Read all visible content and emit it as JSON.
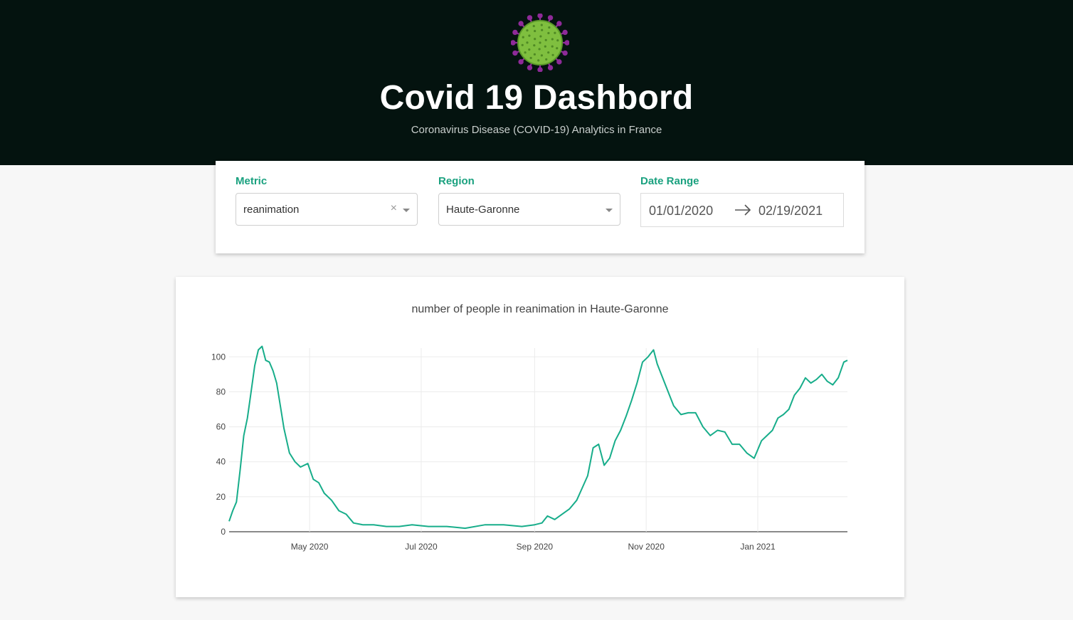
{
  "header": {
    "logo_icon": "virus-icon",
    "title": "Covid 19 Dashbord",
    "subtitle": "Coronavirus Disease (COVID-19) Analytics in France",
    "background": "#04130f"
  },
  "filters": {
    "metric": {
      "label": "Metric",
      "value": "reanimation",
      "clear_symbol": "×"
    },
    "region": {
      "label": "Region",
      "value": "Haute-Garonne"
    },
    "date_range": {
      "label": "Date Range",
      "start": "01/01/2020",
      "end": "02/19/2021",
      "arrow_icon": "arrow-right-icon"
    },
    "accent_color": "#1aa17f"
  },
  "chart_data": {
    "type": "line",
    "title": "number of people in reanimation in Haute-Garonne",
    "xlabel": "",
    "ylabel": "",
    "x_ticks": [
      "May 2020",
      "Jul 2020",
      "Sep 2020",
      "Nov 2020",
      "Jan 2021"
    ],
    "y_ticks": [
      0,
      20,
      40,
      60,
      80,
      100
    ],
    "ylim": [
      0,
      105
    ],
    "grid": true,
    "line_color": "#17ad8a",
    "series": [
      {
        "x": [
          "2020-03-18",
          "2020-03-20",
          "2020-03-22",
          "2020-03-24",
          "2020-03-26",
          "2020-03-28",
          "2020-03-30",
          "2020-04-01",
          "2020-04-03",
          "2020-04-05",
          "2020-04-07",
          "2020-04-09",
          "2020-04-11",
          "2020-04-13",
          "2020-04-15",
          "2020-04-17",
          "2020-04-20",
          "2020-04-23",
          "2020-04-26",
          "2020-04-30",
          "2020-05-03",
          "2020-05-06",
          "2020-05-09",
          "2020-05-13",
          "2020-05-17",
          "2020-05-21",
          "2020-05-25",
          "2020-05-30",
          "2020-06-05",
          "2020-06-12",
          "2020-06-19",
          "2020-06-26",
          "2020-07-05",
          "2020-07-15",
          "2020-07-25",
          "2020-08-05",
          "2020-08-15",
          "2020-08-25",
          "2020-09-01",
          "2020-09-05",
          "2020-09-08",
          "2020-09-12",
          "2020-09-16",
          "2020-09-20",
          "2020-09-24",
          "2020-09-27",
          "2020-09-30",
          "2020-10-03",
          "2020-10-06",
          "2020-10-09",
          "2020-10-12",
          "2020-10-15",
          "2020-10-18",
          "2020-10-21",
          "2020-10-24",
          "2020-10-27",
          "2020-10-30",
          "2020-11-02",
          "2020-11-05",
          "2020-11-07",
          "2020-11-10",
          "2020-11-13",
          "2020-11-16",
          "2020-11-20",
          "2020-11-24",
          "2020-11-28",
          "2020-12-02",
          "2020-12-06",
          "2020-12-10",
          "2020-12-14",
          "2020-12-18",
          "2020-12-22",
          "2020-12-26",
          "2020-12-30",
          "2021-01-03",
          "2021-01-06",
          "2021-01-09",
          "2021-01-12",
          "2021-01-15",
          "2021-01-18",
          "2021-01-21",
          "2021-01-24",
          "2021-01-27",
          "2021-01-30",
          "2021-02-02",
          "2021-02-05",
          "2021-02-08",
          "2021-02-11",
          "2021-02-14",
          "2021-02-17",
          "2021-02-19"
        ],
        "y": [
          6,
          12,
          17,
          35,
          55,
          65,
          80,
          95,
          104,
          106,
          98,
          97,
          92,
          85,
          72,
          59,
          45,
          40,
          37,
          39,
          30,
          28,
          22,
          18,
          12,
          10,
          5,
          4,
          4,
          3,
          3,
          4,
          3,
          3,
          2,
          4,
          4,
          3,
          4,
          5,
          9,
          7,
          10,
          13,
          18,
          25,
          32,
          48,
          50,
          38,
          42,
          52,
          58,
          66,
          75,
          85,
          97,
          100,
          104,
          96,
          88,
          80,
          72,
          67,
          68,
          68,
          60,
          55,
          58,
          57,
          50,
          50,
          45,
          42,
          52,
          55,
          58,
          65,
          67,
          70,
          78,
          82,
          88,
          85,
          87,
          90,
          86,
          84,
          88,
          97,
          98
        ]
      }
    ]
  }
}
